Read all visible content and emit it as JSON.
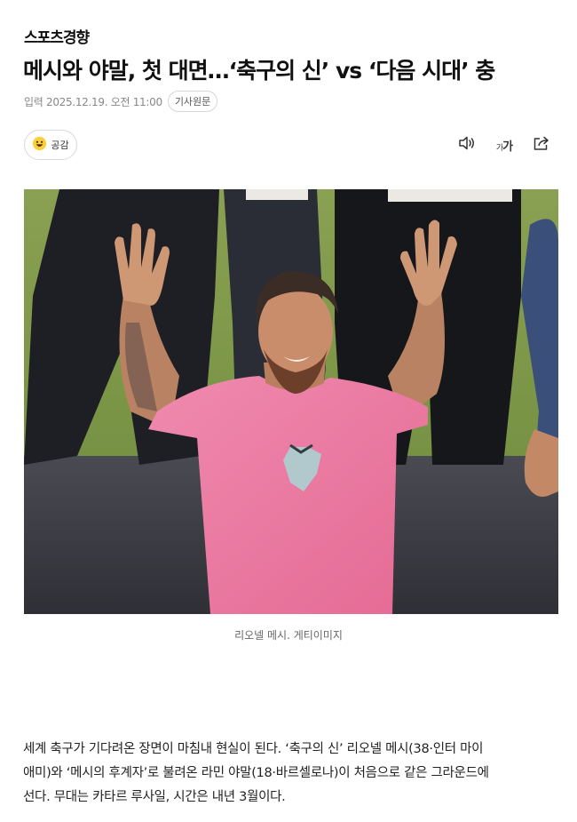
{
  "article": {
    "brand": "스포츠경향",
    "headline": "메시와 야말, 첫 대면…‘축구의 신’ vs ‘다음 시대’ 충",
    "date": "입력 2025.12.19. 오전 11:00",
    "original_label": "기사원문",
    "reaction_label": "공감",
    "font_size_label_small": "가",
    "font_size_label": "가",
    "photo_caption": "리오넬 메시. 게티이미지",
    "body_lines": [
      "세계 축구가 기다려온 장면이 마침내 현실이 된다. ‘축구의 신’ 리오넬 메시(38·인터 마이",
      "애미)와 ‘메시의 후계자’로 불려온 라민 야말(18·바르셀로나)이 처음으로 같은 그라운드에",
      "선다. 무대는 카타르 루사일, 시간은 내년 3월이다."
    ]
  },
  "icons": {
    "reaction": "smile-emoji-icon",
    "listen": "speaker-icon",
    "font": "font-size-icon",
    "share": "share-icon"
  },
  "colors": {
    "shirt": "#e9759e",
    "grass": "#7c9547",
    "track": "#3d3d45"
  }
}
